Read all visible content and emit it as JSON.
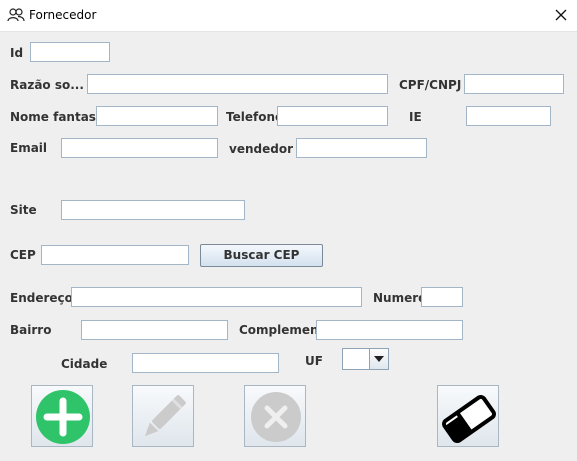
{
  "window": {
    "title": "Fornecedor",
    "title_icon": "users-icon",
    "close_icon": "close-icon"
  },
  "labels": {
    "id": "Id",
    "razao_social": "Razão so...",
    "cpf_cnpj": "CPF/CNPJ",
    "nome_fantasia": "Nome fantasia",
    "telefone": "Telefone",
    "ie": "IE",
    "email": "Email",
    "vendedor": "vendedor",
    "site": "Site",
    "cep": "CEP",
    "endereco": "Endereço",
    "numero": "Numero",
    "bairro": "Bairro",
    "complemento": "Complemento",
    "cidade": "Cidade",
    "uf": "UF"
  },
  "fields": {
    "id": "",
    "razao_social": "",
    "cpf_cnpj": "",
    "nome_fantasia": "",
    "telefone": "",
    "ie": "",
    "email": "",
    "vendedor": "",
    "site": "",
    "cep": "",
    "endereco": "",
    "numero": "",
    "bairro": "",
    "complemento": "",
    "cidade": "",
    "uf": ""
  },
  "buttons": {
    "buscar_cep": "Buscar CEP"
  },
  "actions": [
    {
      "icon": "add-icon",
      "color": "#2fc46a",
      "enabled": true
    },
    {
      "icon": "pencil-icon",
      "color": "#c8c8c8",
      "enabled": false
    },
    {
      "icon": "delete-icon",
      "color": "#c8c8c8",
      "enabled": false
    },
    {
      "icon": "eraser-icon",
      "color": "#000000",
      "enabled": true
    }
  ]
}
